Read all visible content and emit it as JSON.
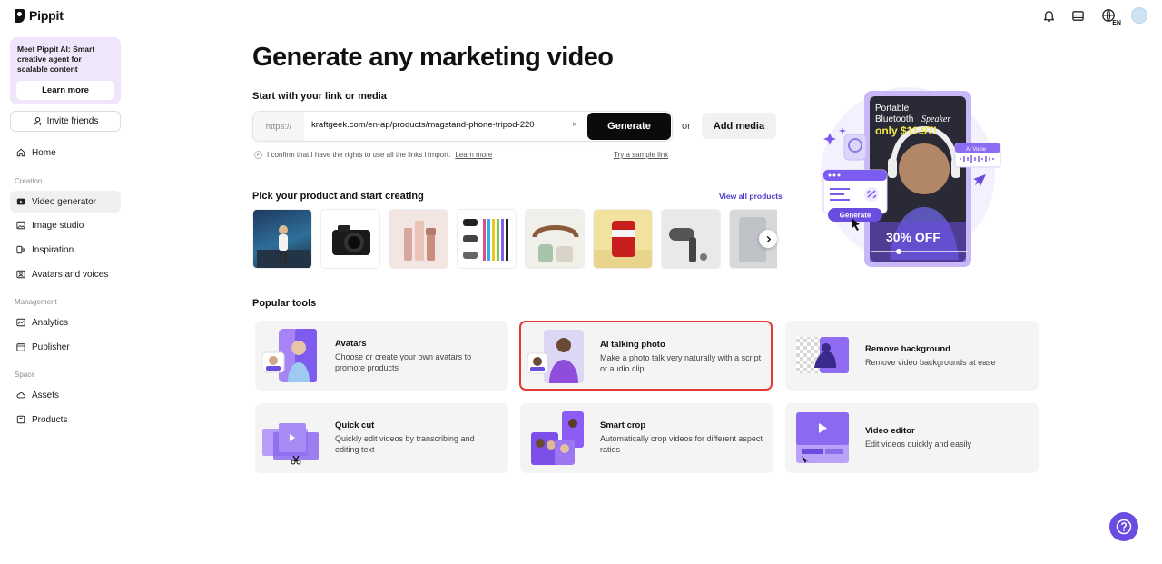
{
  "app": {
    "brand": "Pippit"
  },
  "sidebar": {
    "promo_text": "Meet Pippit AI: Smart creative agent for scalable content",
    "promo_button": "Learn more",
    "invite_label": "Invite friends",
    "home": "Home",
    "section_creation": "Creation",
    "creation_items": [
      "Video generator",
      "Image studio",
      "Inspiration",
      "Avatars and voices"
    ],
    "section_management": "Management",
    "management_items": [
      "Analytics",
      "Publisher"
    ],
    "section_space": "Space",
    "space_items": [
      "Assets",
      "Products"
    ]
  },
  "header": {
    "language": "EN"
  },
  "main": {
    "headline": "Generate any marketing video",
    "subheading": "Start with your link or media",
    "link_prefix": "https://",
    "link_value": "kraftgeek.com/en-ap/products/magstand-phone-tripod-220",
    "clear": "×",
    "generate_label": "Generate",
    "or": "or",
    "add_media": "Add media",
    "confirm_text": "I confirm that I have the rights to use all the links I import.",
    "confirm_learn_more": "Learn more",
    "sample_link": "Try a sample link",
    "pick_title": "Pick your product and start creating",
    "view_all": "View all products",
    "popular_title": "Popular tools"
  },
  "tools": [
    {
      "title": "Avatars",
      "desc": "Choose or create your own avatars to promote products"
    },
    {
      "title": "AI talking photo",
      "desc": "Make a photo talk very naturally with a script or audio clip"
    },
    {
      "title": "Remove background",
      "desc": "Remove video backgrounds at ease"
    },
    {
      "title": "Quick cut",
      "desc": "Quickly edit videos by transcribing and editing text"
    },
    {
      "title": "Smart crop",
      "desc": "Automatically crop videos for different aspect ratios"
    },
    {
      "title": "Video editor",
      "desc": "Edit videos quickly and easily"
    }
  ],
  "hero": {
    "line1": "Portable",
    "line2": "Bluetooth",
    "line2b": "Speaker",
    "price": "only $11.97!",
    "ai_voice": "AI Vocie",
    "generate": "Generate",
    "discount": "30% OFF"
  },
  "colors": {
    "accent": "#6a4ce0",
    "selected_border": "#e53935",
    "link": "#4b3cc6"
  }
}
